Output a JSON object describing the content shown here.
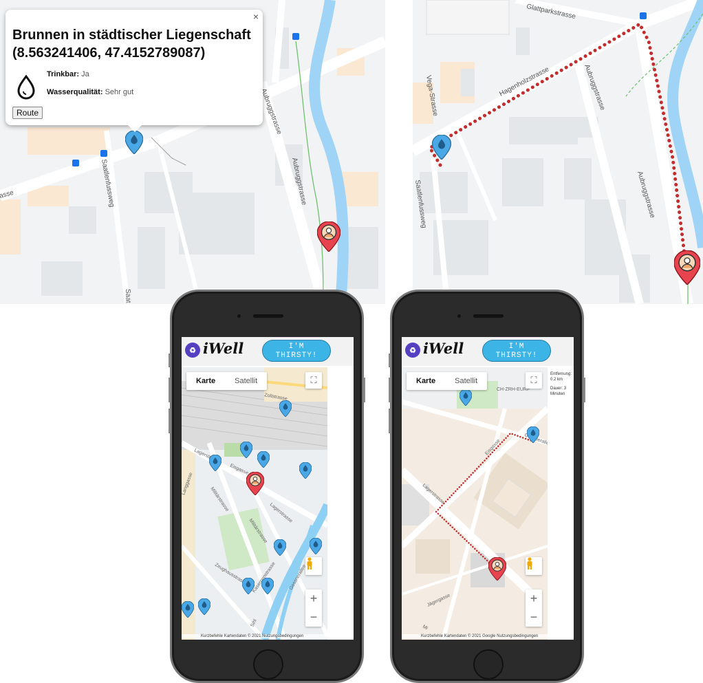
{
  "popup": {
    "close": "×",
    "title_line1": "Brunnen in städtischer Liegenschaft",
    "title_line2": "(8.563241406, 47.4152789087)",
    "drinkable_label": "Trinkbar:",
    "drinkable_value": "Ja",
    "quality_label": "Wasserqualität:",
    "quality_value": "Sehr gut",
    "route_button": "Route"
  },
  "map_a": {
    "streets": [
      "Aubruggstrasse",
      "Saatlenfussweg",
      "asse",
      "Aubruggstrasse",
      "Saat"
    ]
  },
  "map_b": {
    "streets": [
      "Glattparkstrasse",
      "Hagenholzstrasse",
      "Aubruggstrasse",
      "Aubruggstrasse",
      "Vega-Strasse",
      "Saatlenfussweg"
    ]
  },
  "app": {
    "logo_letter": "♻",
    "logo": "iWell",
    "thirsty_line1": "I'M",
    "thirsty_line2": "THIRSTY!",
    "map_type_map": "Karte",
    "map_type_satellite": "Satellit",
    "zoom_in": "+",
    "zoom_out": "−",
    "fullscreen_icon": "⛶",
    "footer": "Kurzbefehle   Kartendaten © 2021   Nutzungsbedingungen",
    "footer2": "Kurzbefehle   Kartendaten © 2021 Google   Nutzungsbedingungen"
  },
  "phone1_map": {
    "streets": [
      "Zollstrasse",
      "Lagerstrasse",
      "Eisgasse",
      "Militärstrasse",
      "Lagerstrasse",
      "Militärstrasse",
      "Kasernenstrasse",
      "Gessnerallee",
      "Sihl",
      "Zeughausstrasse",
      "Langgasse"
    ]
  },
  "phone2_map": {
    "streets": [
      "CH-ZRH-EURF",
      "Lagerstrasse",
      "Eisgasse",
      "Gessnerallee",
      "Jägergasse",
      "Mi"
    ],
    "distance_label": "Entfernung:",
    "distance_value": "0.2 km",
    "duration_label": "Dauer:",
    "duration_value": "3 Minuten"
  },
  "colors": {
    "water_pin": "#4aa8e6",
    "user_pin": "#e8444f",
    "route": "#c22d2d",
    "river": "#9fd4f7",
    "thirsty_button": "#3cb4e5"
  }
}
